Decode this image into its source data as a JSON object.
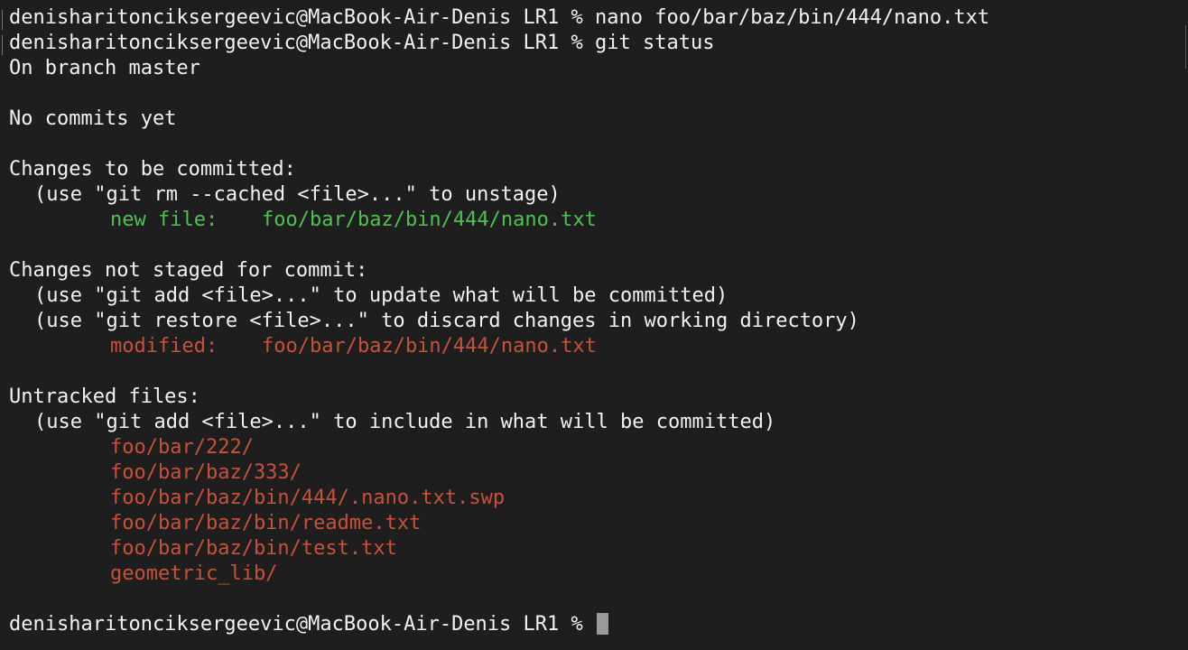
{
  "theme": {
    "background": "#1e1e1e",
    "text": "#f2f2f2",
    "staged": "#4ec24e",
    "unstaged": "#c9513a",
    "cursor": "#9a9a9a"
  },
  "terminal": {
    "prompt": "denisharitonciksergeevic@MacBook-Air-Denis LR1 % ",
    "commands": {
      "nano": "nano foo/bar/baz/bin/444/nano.txt",
      "git_status": "git status"
    },
    "output": {
      "branch": "On branch master",
      "no_commits": "No commits yet",
      "staged_header": "Changes to be committed:",
      "staged_hint": "(use \"git rm --cached <file>...\" to unstage)",
      "staged_entry": {
        "status": "new file:",
        "path": "foo/bar/baz/bin/444/nano.txt"
      },
      "unstaged_header": "Changes not staged for commit:",
      "unstaged_hint_add": "(use \"git add <file>...\" to update what will be committed)",
      "unstaged_hint_restore": "(use \"git restore <file>...\" to discard changes in working directory)",
      "unstaged_entry": {
        "status": "modified:",
        "path": "foo/bar/baz/bin/444/nano.txt"
      },
      "untracked_header": "Untracked files:",
      "untracked_hint": "(use \"git add <file>...\" to include in what will be committed)",
      "untracked_files": [
        "foo/bar/222/",
        "foo/bar/baz/333/",
        "foo/bar/baz/bin/444/.nano.txt.swp",
        "foo/bar/baz/bin/readme.txt",
        "foo/bar/baz/bin/test.txt",
        "geometric_lib/"
      ]
    }
  }
}
